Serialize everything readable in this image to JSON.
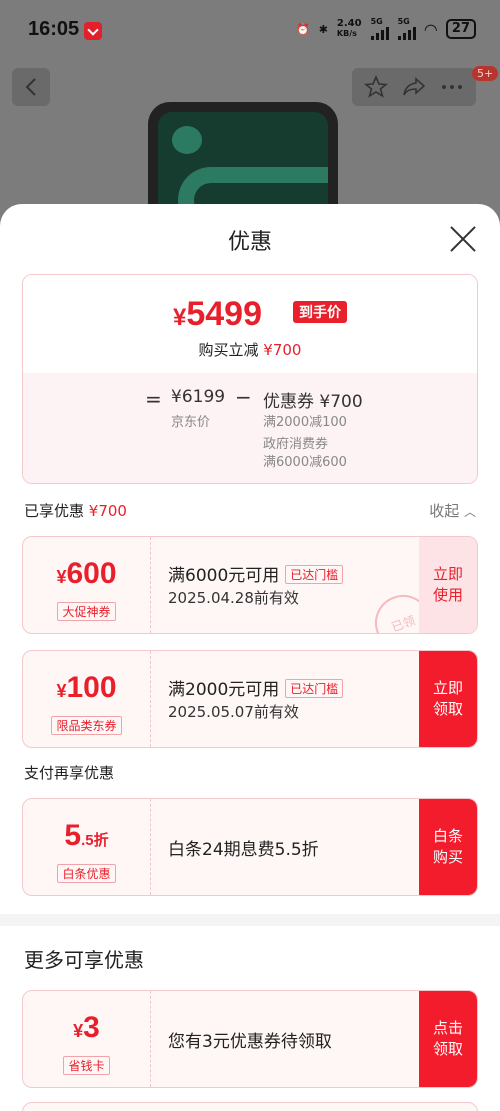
{
  "status_bar": {
    "time": "16:05",
    "net_speed_top": "2.40",
    "net_speed_bottom": "KB/s",
    "signal1": "5G",
    "signal2": "5G",
    "battery": "27"
  },
  "top_nav": {
    "cart_badge": "5+"
  },
  "sheet": {
    "title": "优惠",
    "summary": {
      "price_currency": "¥",
      "price_value": "5499",
      "price_tag": "到手价",
      "save_text": "购买立减",
      "save_amount": "¥700",
      "eq": "=",
      "jd_price": "¥6199",
      "jd_price_label": "京东价",
      "minus": "−",
      "coupon_total": "优惠券 ¥700",
      "coupon_line1": "满2000减100",
      "coupon_line2": "政府消费券",
      "coupon_line3": "满6000减600"
    },
    "enjoyed": {
      "label": "已享优惠",
      "amount": "¥700",
      "collapse": "收起"
    },
    "coupons": [
      {
        "currency": "¥",
        "amount": "600",
        "kind": "大促神券",
        "condition": "满6000元可用",
        "cond_tag": "已达门槛",
        "valid": "2025.04.28前有效",
        "action": "立即使用",
        "stamp": "已领"
      },
      {
        "currency": "¥",
        "amount": "100",
        "kind": "限品类东券",
        "condition": "满2000元可用",
        "cond_tag": "已达门槛",
        "valid": "2025.05.07前有效",
        "action": "立即领取"
      }
    ],
    "pay_section": {
      "label": "支付再享优惠",
      "amount": "5",
      "amount_unit": ".5折",
      "kind": "白条优惠",
      "desc": "白条24期息费5.5折",
      "action": "白条购买"
    },
    "more": {
      "title": "更多可享优惠",
      "currency": "¥",
      "amount": "3",
      "kind": "省钱卡",
      "desc": "您有3元优惠券待领取",
      "action": "点击领取"
    }
  }
}
